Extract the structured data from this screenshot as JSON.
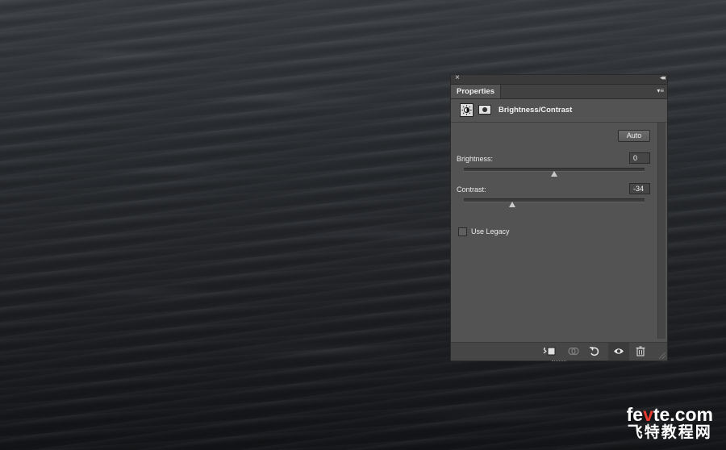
{
  "panel": {
    "tab_label": "Properties",
    "adjustment_title": "Brightness/Contrast",
    "auto_label": "Auto",
    "brightness": {
      "label": "Brightness:",
      "value": "0",
      "slider_fraction": 0.5
    },
    "contrast": {
      "label": "Contrast:",
      "value": "-34",
      "slider_fraction": 0.27
    },
    "use_legacy": {
      "label": "Use Legacy",
      "checked": false
    }
  },
  "watermark": {
    "site_prefix": "fe",
    "site_mid": "v",
    "site_suffix": "te.com",
    "site_cn": "飞特教程网"
  },
  "icons": {
    "close": "close-icon",
    "collapse": "double-chevron-icon",
    "menu": "panel-menu-icon",
    "adjustment": "brightness-contrast-icon",
    "mask": "layer-mask-icon",
    "clip": "clip-to-layer-icon",
    "view_previous": "view-previous-state-icon",
    "reset": "reset-icon",
    "visibility": "eye-icon",
    "delete": "trash-icon"
  },
  "colors": {
    "panel_bg": "#535353",
    "panel_dark": "#464646",
    "watermark_red": "#e53b2f"
  }
}
